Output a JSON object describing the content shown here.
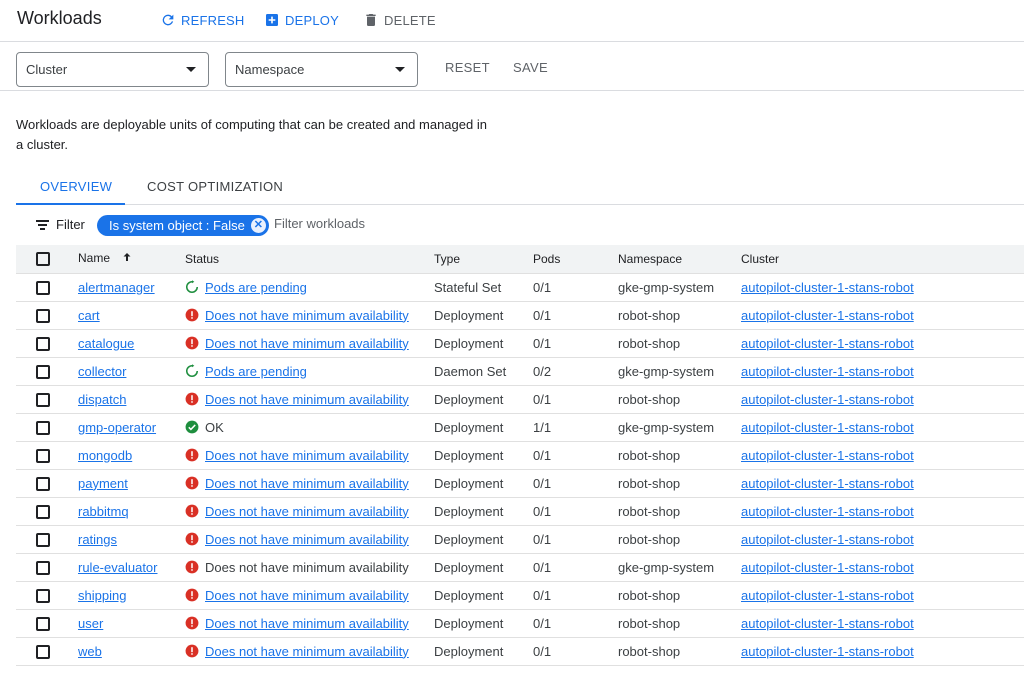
{
  "header": {
    "title": "Workloads",
    "refresh_label": "REFRESH",
    "deploy_label": "DEPLOY",
    "delete_label": "DELETE"
  },
  "filters": {
    "cluster_value": "Cluster",
    "namespace_value": "Namespace",
    "reset_label": "RESET",
    "save_label": "SAVE"
  },
  "description": "Workloads are deployable units of computing that can be created and managed in a cluster.",
  "tabs": [
    {
      "label": "OVERVIEW",
      "active": true
    },
    {
      "label": "COST OPTIMIZATION",
      "active": false
    }
  ],
  "filter_bar": {
    "label": "Filter",
    "chip": "Is system object : False",
    "placeholder": "Filter workloads"
  },
  "colors": {
    "accent": "#1a73e8",
    "error": "#d93025",
    "ok": "#1e8e3e"
  },
  "table": {
    "columns": [
      "Name",
      "Status",
      "Type",
      "Pods",
      "Namespace",
      "Cluster"
    ],
    "rows": [
      {
        "name": "alertmanager",
        "status": "Pods are pending",
        "status_icon": "pending-icon",
        "status_link": true,
        "type": "Stateful Set",
        "pods": "0/1",
        "namespace": "gke-gmp-system",
        "cluster": "autopilot-cluster-1-stans-robot"
      },
      {
        "name": "cart",
        "status": "Does not have minimum availability",
        "status_icon": "error-icon",
        "status_link": true,
        "type": "Deployment",
        "pods": "0/1",
        "namespace": "robot-shop",
        "cluster": "autopilot-cluster-1-stans-robot"
      },
      {
        "name": "catalogue",
        "status": "Does not have minimum availability",
        "status_icon": "error-icon",
        "status_link": true,
        "type": "Deployment",
        "pods": "0/1",
        "namespace": "robot-shop",
        "cluster": "autopilot-cluster-1-stans-robot"
      },
      {
        "name": "collector",
        "status": "Pods are pending",
        "status_icon": "pending-icon",
        "status_link": true,
        "type": "Daemon Set",
        "pods": "0/2",
        "namespace": "gke-gmp-system",
        "cluster": "autopilot-cluster-1-stans-robot"
      },
      {
        "name": "dispatch",
        "status": "Does not have minimum availability",
        "status_icon": "error-icon",
        "status_link": true,
        "type": "Deployment",
        "pods": "0/1",
        "namespace": "robot-shop",
        "cluster": "autopilot-cluster-1-stans-robot"
      },
      {
        "name": "gmp-operator",
        "status": "OK",
        "status_icon": "ok-icon",
        "status_link": false,
        "type": "Deployment",
        "pods": "1/1",
        "namespace": "gke-gmp-system",
        "cluster": "autopilot-cluster-1-stans-robot"
      },
      {
        "name": "mongodb",
        "status": "Does not have minimum availability",
        "status_icon": "error-icon",
        "status_link": true,
        "type": "Deployment",
        "pods": "0/1",
        "namespace": "robot-shop",
        "cluster": "autopilot-cluster-1-stans-robot"
      },
      {
        "name": "payment",
        "status": "Does not have minimum availability",
        "status_icon": "error-icon",
        "status_link": true,
        "type": "Deployment",
        "pods": "0/1",
        "namespace": "robot-shop",
        "cluster": "autopilot-cluster-1-stans-robot"
      },
      {
        "name": "rabbitmq",
        "status": "Does not have minimum availability",
        "status_icon": "error-icon",
        "status_link": true,
        "type": "Deployment",
        "pods": "0/1",
        "namespace": "robot-shop",
        "cluster": "autopilot-cluster-1-stans-robot"
      },
      {
        "name": "ratings",
        "status": "Does not have minimum availability",
        "status_icon": "error-icon",
        "status_link": true,
        "type": "Deployment",
        "pods": "0/1",
        "namespace": "robot-shop",
        "cluster": "autopilot-cluster-1-stans-robot"
      },
      {
        "name": "rule-evaluator",
        "status": "Does not have minimum availability",
        "status_icon": "error-icon",
        "status_link": false,
        "type": "Deployment",
        "pods": "0/1",
        "namespace": "gke-gmp-system",
        "cluster": "autopilot-cluster-1-stans-robot"
      },
      {
        "name": "shipping",
        "status": "Does not have minimum availability",
        "status_icon": "error-icon",
        "status_link": true,
        "type": "Deployment",
        "pods": "0/1",
        "namespace": "robot-shop",
        "cluster": "autopilot-cluster-1-stans-robot"
      },
      {
        "name": "user",
        "status": "Does not have minimum availability",
        "status_icon": "error-icon",
        "status_link": true,
        "type": "Deployment",
        "pods": "0/1",
        "namespace": "robot-shop",
        "cluster": "autopilot-cluster-1-stans-robot"
      },
      {
        "name": "web",
        "status": "Does not have minimum availability",
        "status_icon": "error-icon",
        "status_link": true,
        "type": "Deployment",
        "pods": "0/1",
        "namespace": "robot-shop",
        "cluster": "autopilot-cluster-1-stans-robot"
      }
    ]
  }
}
